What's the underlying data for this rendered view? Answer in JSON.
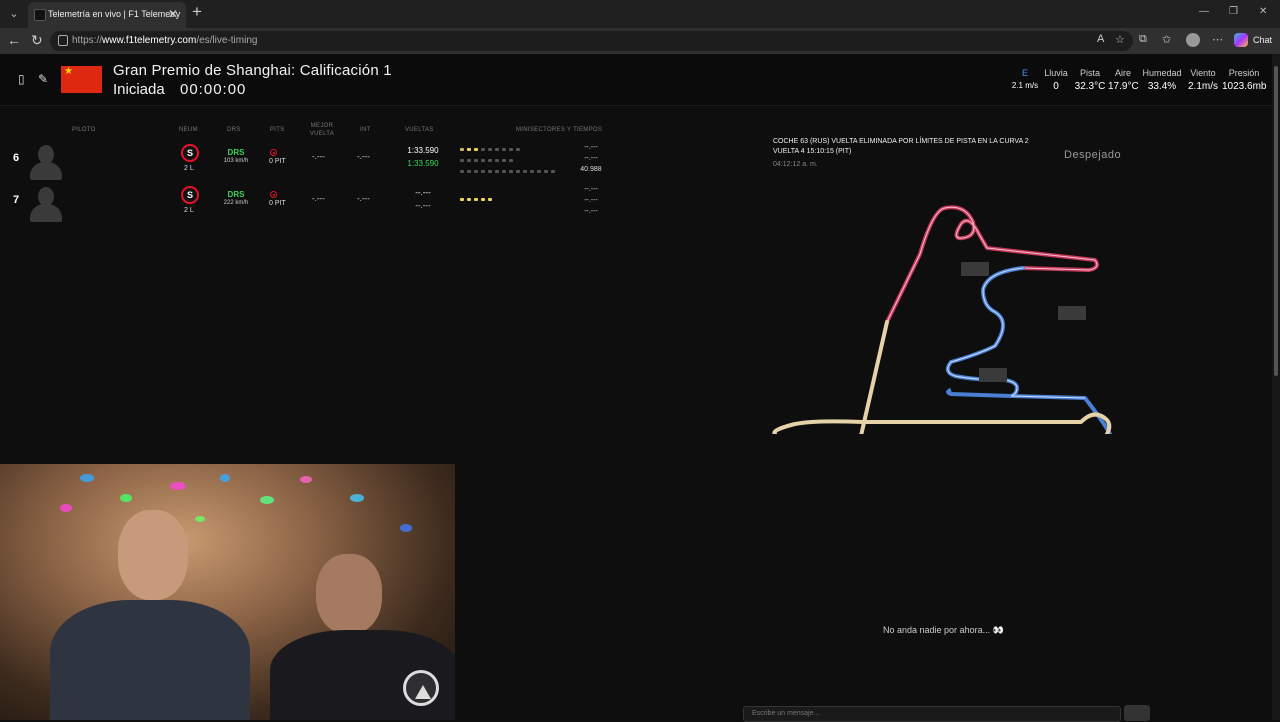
{
  "browser": {
    "tab_title": "Telemetría en vivo | F1 Telemetry",
    "url_prefix": "https://",
    "url_host": "www.f1telemetry.com",
    "url_path": "/es/live-timing",
    "chat_label": "Chat"
  },
  "header": {
    "title": "Gran Premio de Shanghai: Calificación 1",
    "status": "Iniciada",
    "clock": "00:00:00",
    "flag": "China",
    "weather": {
      "wind_dir": {
        "label": "E",
        "value": "2.1 m/s"
      },
      "rain": {
        "label": "Lluvia",
        "value": "0"
      },
      "track": {
        "label": "Pista",
        "value": "32.3°C"
      },
      "air": {
        "label": "Aire",
        "value": "17.9°C"
      },
      "humidity": {
        "label": "Humedad",
        "value": "33.4%"
      },
      "wind": {
        "label": "Viento",
        "value": "2.1m/s"
      },
      "pressure": {
        "label": "Presión",
        "value": "1023.6mb"
      }
    }
  },
  "table": {
    "headers": {
      "driver": "PILOTO",
      "tyre": "NEUM",
      "drs": "DRS",
      "pits": "PITS",
      "best_lap_1": "MEJOR",
      "best_lap_2": "VUELTA",
      "int": "INT",
      "laps": "VUELTAS",
      "minisectors": "MINISECTORES Y TIEMPOS"
    },
    "rows": [
      {
        "position": "6",
        "tyre": "S",
        "tyre_age": "2 L",
        "drs": "DRS",
        "speed": "103 km/h",
        "pits": "0 PIT",
        "best": "-.---",
        "int": "-.---",
        "last_lap": "1:33.590",
        "best_lap": "1:33.590",
        "sector1": "--.---",
        "sector2": "--.---",
        "sector3": "40.988"
      },
      {
        "position": "7",
        "tyre": "S",
        "tyre_age": "2 L",
        "drs": "DRS",
        "speed": "222 km/h",
        "pits": "0 PIT",
        "best": "-.---",
        "int": "-.---",
        "last_lap": "--.---",
        "best_lap": "--.---",
        "sector1": "--.---",
        "sector2": "--.---",
        "sector3": "--.---"
      }
    ]
  },
  "race_control": {
    "line1": "COCHE 63 (RUS) VUELTA ELIMINADA POR LÍMITES DE PISTA EN LA CURVA 2",
    "line2": "VUELTA 4 15:10:15 (PIT)",
    "time": "04:12:12 a. m."
  },
  "weather_word": "Despejado",
  "chat": {
    "empty": "No anda nadie por ahora... 👀",
    "placeholder": "Escribe un mensaje..."
  },
  "colors": {
    "soft_tyre": "#e8102a",
    "drs_green": "#39d35a",
    "track_red_sector": "#c8385a",
    "track_blue_sector": "#4a7fd4",
    "track_yellow_sector": "#e6d2a8",
    "minisector_yellow": "#f1d55a"
  }
}
